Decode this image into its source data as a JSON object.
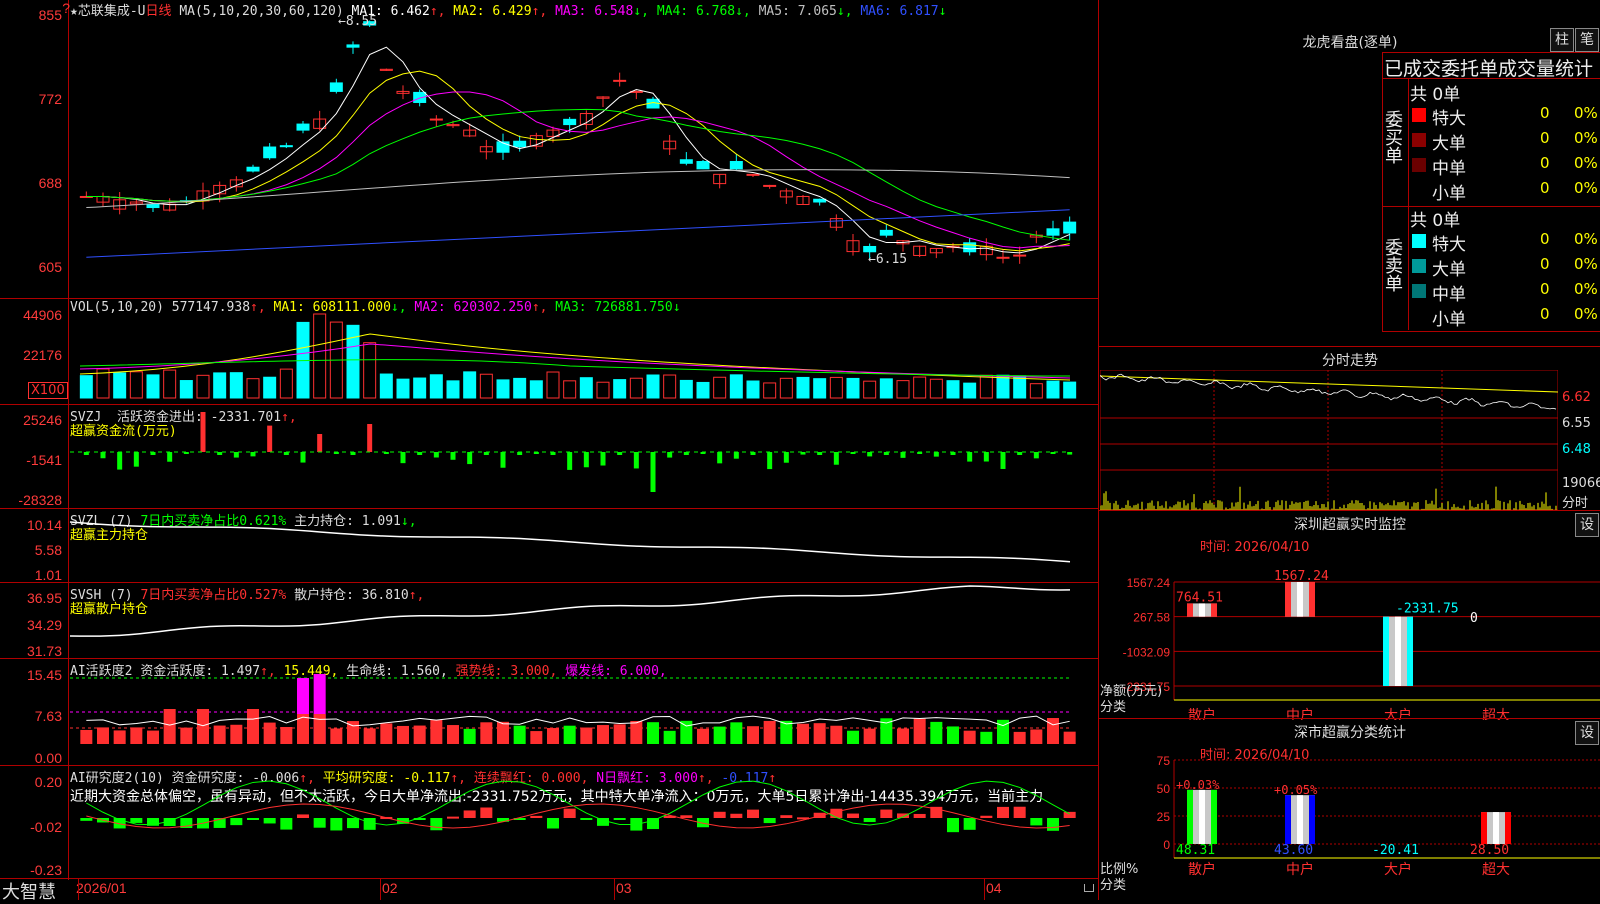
{
  "stock": {
    "name_header": "★芯联集成-U",
    "period": "日线",
    "ma_header": "MA(5,10,20,30,60,120)",
    "ma_values": [
      {
        "label": "MA1: 6.462",
        "arrow": "↑",
        "color": "#ffffff"
      },
      {
        "label": "MA2: 6.429",
        "arrow": "↑",
        "color": "#ffff00"
      },
      {
        "label": "MA3: 6.548",
        "arrow": "↓",
        "color": "#ff00ff"
      },
      {
        "label": "MA4: 6.768",
        "arrow": "↓",
        "color": "#00ff00"
      },
      {
        "label": "MA5: 7.065",
        "arrow": "↓",
        "color": "#c0c0c0"
      },
      {
        "label": "MA6: 6.817",
        "arrow": "↓",
        "color": "#3050ff"
      }
    ],
    "ylabels": [
      "855",
      "772",
      "688",
      "605"
    ],
    "high_marker": "8.55",
    "low_marker": "6.15",
    "question_mark": "?"
  },
  "volume": {
    "header": "VOL(5,10,20)",
    "value": "577147.938",
    "ma1": "MA1: 608111.000",
    "ma2": "MA2: 620302.250",
    "ma3": "MA3: 726881.750",
    "ylabels": [
      "44906",
      "22176"
    ],
    "unit": "X100"
  },
  "svzj": {
    "name": "SVZJ",
    "label": "活跃资金进出: -2331.701",
    "sub": "超赢资金流(万元)",
    "ylabels": [
      "25246",
      "-1541",
      "-28328"
    ]
  },
  "svzl": {
    "name": "SVZL (7)",
    "ratio": "7日内买卖净占比0.621%",
    "hold": "主力持仓: 1.091",
    "sub": "超赢主力持仓",
    "ylabels": [
      "10.14",
      "5.58",
      "1.01"
    ]
  },
  "svsh": {
    "name": "SVSH (7)",
    "ratio": "7日内买卖净占比0.527%",
    "hold": "散户持仓: 36.810",
    "sub": "超赢散户持仓",
    "ylabels": [
      "36.95",
      "34.29",
      "31.73"
    ]
  },
  "ai_active": {
    "name": "AI活跃度2",
    "a": "资金活跃度: 1.497",
    "b": "15.449,",
    "c": "生命线: 1.560,",
    "d": "强势线: 3.000,",
    "e": "爆发线: 6.000,",
    "ylabels": [
      "15.45",
      "7.63",
      "0.00"
    ]
  },
  "ai_research": {
    "name": "AI研究度2(10)",
    "a": "资金研究度: -0.006",
    "b": "平均研究度: -0.117",
    "c": "连续飘红: 0.000,",
    "d": "N日飘红: 3.000",
    "e": "-0.117",
    "summary": "近期大资金总体偏空，虽有异动，但不太活跃，今日大单净流出:-2331.752万元，其中特大单净流入：0万元，大单5日累计净出-14435.394万元，当前主力",
    "ylabels": [
      "0.20",
      "-0.02",
      "-0.23"
    ]
  },
  "xaxis": {
    "logo": "大智慧",
    "labels": [
      "2026/01",
      "02",
      "03",
      "04"
    ]
  },
  "longhu": {
    "title": "龙虎看盘(逐单)",
    "tab_bar": "柱",
    "tab_stroke": "笔",
    "subtitle": "已成交委托单成交量统计",
    "buy_group": "委买单",
    "sell_group": "委卖单",
    "buy_total": "共 0单",
    "sell_total": "共 0单",
    "buy_rows": [
      {
        "label": "特大",
        "val": "0",
        "pct": "0%",
        "color": "#ff0000"
      },
      {
        "label": "大单",
        "val": "0",
        "pct": "0%",
        "color": "#8b0000"
      },
      {
        "label": "中单",
        "val": "0",
        "pct": "0%",
        "color": "#6a0000"
      },
      {
        "label": "小单",
        "val": "0",
        "pct": "0%",
        "color": "#000000"
      }
    ],
    "sell_rows": [
      {
        "label": "特大",
        "val": "0",
        "pct": "0%",
        "color": "#00ffff"
      },
      {
        "label": "大单",
        "val": "0",
        "pct": "0%",
        "color": "#009999"
      },
      {
        "label": "中单",
        "val": "0",
        "pct": "0%",
        "color": "#007777"
      },
      {
        "label": "小单",
        "val": "0",
        "pct": "0%",
        "color": "#000000"
      }
    ]
  },
  "intraday": {
    "title": "分时走势",
    "labels": [
      "6.62",
      "6.55",
      "6.48"
    ],
    "vol_label": "19066",
    "vol_unit": "分时"
  },
  "monitor": {
    "title": "深圳超赢实时监控",
    "settings": "设",
    "time": "时间: 2026/04/10",
    "ylabels": [
      "1567.24",
      "267.58",
      "-1032.09",
      "-2331.75"
    ],
    "y_unit": "净额(万元)",
    "x_unit": "分类",
    "categories": [
      "散户",
      "中户",
      "大户",
      "超大"
    ],
    "values": [
      764.51,
      1567.24,
      -2331.75,
      0
    ],
    "value_labels": [
      "764.51",
      "1567.24",
      "-2331.75",
      "0"
    ]
  },
  "classify": {
    "title": "深市超赢分类统计",
    "settings": "设",
    "time": "时间: 2026/04/10",
    "ylabels": [
      "75",
      "50",
      "25",
      "0"
    ],
    "y_unit": "比例%",
    "x_unit": "分类",
    "categories": [
      "散户",
      "中户",
      "大户",
      "超大"
    ],
    "values": [
      48.31,
      43.6,
      -20.41,
      28.5
    ],
    "value_labels": [
      "48.31",
      "43.60",
      "-20.41",
      "28.50"
    ],
    "top_labels": [
      "+0.03%",
      "+0.05%"
    ]
  },
  "colors": {
    "up": "#ff3030",
    "down": "#00ffff",
    "grid": "#b00000",
    "yellow": "#ffff00",
    "magenta": "#ff00ff",
    "green": "#00ff00"
  }
}
